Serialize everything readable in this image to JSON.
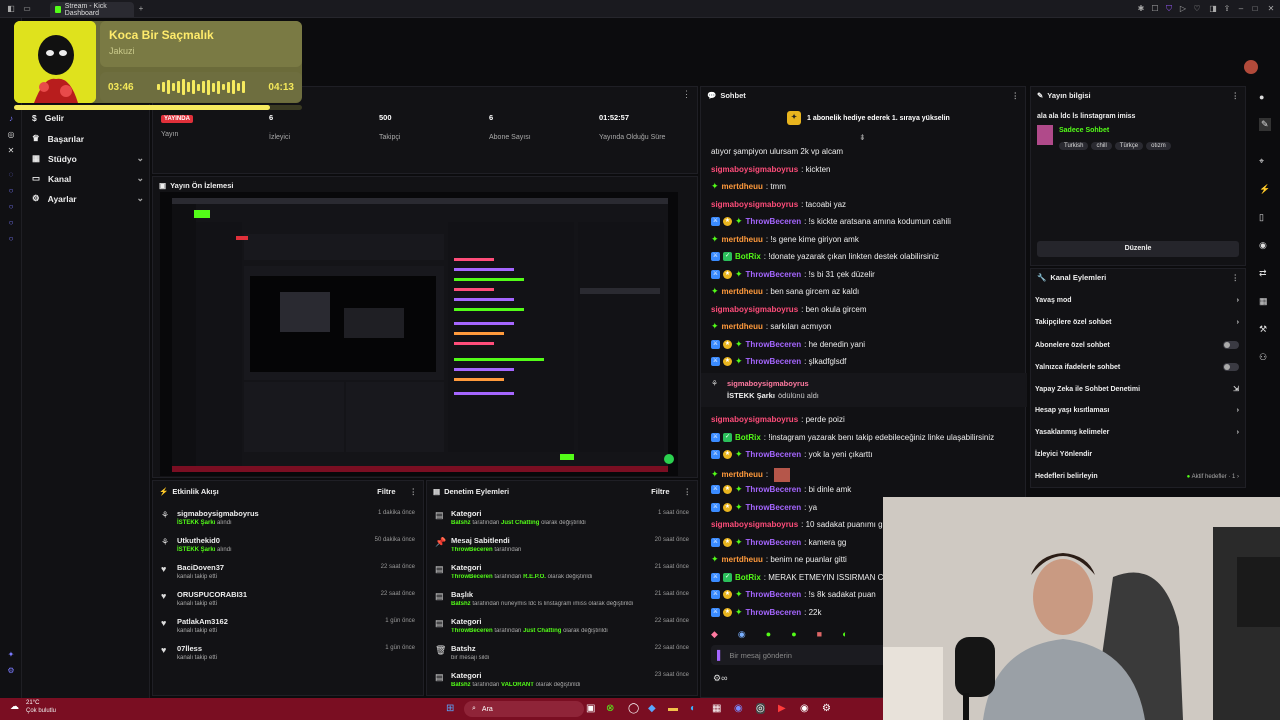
{
  "browser": {
    "tab_title": "Stream - Kick Dashboard"
  },
  "now_playing": {
    "title": "Koca Bir Saçmalık",
    "artist": "Jakuzi",
    "elapsed": "03:46",
    "duration": "04:13",
    "progress": 0.89
  },
  "nav": [
    {
      "label": "Gelir",
      "expandable": false
    },
    {
      "label": "Başarılar",
      "expandable": false
    },
    {
      "label": "Stüdyo",
      "expandable": true
    },
    {
      "label": "Kanal",
      "expandable": true
    },
    {
      "label": "Ayarlar",
      "expandable": true
    }
  ],
  "stats": [
    {
      "value": "YAYINDA",
      "label": "Yayın"
    },
    {
      "value": "6",
      "label": "İzleyici"
    },
    {
      "value": "500",
      "label": "Takipçi"
    },
    {
      "value": "6",
      "label": "Abone Sayısı"
    },
    {
      "value": "01:52:57",
      "label": "Yayında Olduğu Süre"
    }
  ],
  "preview": {
    "title": "Yayın Ön İzlemesi"
  },
  "activity": {
    "title": "Etkinlik Akışı",
    "filter": "Filtre",
    "items": [
      {
        "name": "sigmaboysigmaboyrus",
        "sub": "İSTEKK Şarkı",
        "sub2": "alındı",
        "time": "1 dakika önce"
      },
      {
        "name": "Utkuthekid0",
        "sub": "İSTEKK Şarkı",
        "sub2": "alındı",
        "time": "50 dakika önce"
      },
      {
        "name": "BaciDoven37",
        "sub": "",
        "sub2": "kanalı takip etti",
        "time": "22 saat önce"
      },
      {
        "name": "ORUSPUCORABI31",
        "sub": "",
        "sub2": "kanalı takip etti",
        "time": "22 saat önce"
      },
      {
        "name": "PatlakAm3162",
        "sub": "",
        "sub2": "kanalı takip etti",
        "time": "1 gün önce"
      },
      {
        "name": "07lless",
        "sub": "",
        "sub2": "kanalı takip etti",
        "time": "1 gün önce"
      }
    ]
  },
  "moderation": {
    "title": "Denetim Eylemleri",
    "filter": "Filtre",
    "items": [
      {
        "title": "Kategori",
        "actor": "Batshz",
        "mid": "tarafından",
        "target": "Just Chatting",
        "end": "olarak değiştirildi",
        "time": "1 saat önce"
      },
      {
        "title": "Mesaj Sabitlendi",
        "actor": "ThrowBeceren",
        "mid": "tarafından",
        "target": "",
        "end": "",
        "time": "20 saat önce"
      },
      {
        "title": "Kategori",
        "actor": "ThrowBeceren",
        "mid": "tarafından",
        "target": "R.E.P.O.",
        "end": "olarak değiştirildi",
        "time": "21 saat önce"
      },
      {
        "title": "Başlık",
        "actor": "Batshz",
        "mid": "tarafından",
        "target": "",
        "end": "nuneymis ldc ls linstagram imiss olarak değiştirildi",
        "time": "21 saat önce"
      },
      {
        "title": "Kategori",
        "actor": "ThrowBeceren",
        "mid": "tarafından",
        "target": "Just Chatting",
        "end": "olarak değiştirildi",
        "time": "22 saat önce"
      },
      {
        "title": "Batshz",
        "actor": "",
        "mid": "bir mesajı sildi",
        "target": "",
        "end": "",
        "time": "22 saat önce"
      },
      {
        "title": "Kategori",
        "actor": "Batshz",
        "mid": "tarafından",
        "target": "VALORANT",
        "end": "olarak değiştirildi",
        "time": "23 saat önce"
      }
    ]
  },
  "chat": {
    "title": "Sohbet",
    "banner": "1 abonelik hediye ederek 1. sıraya yükselin",
    "input_placeholder": "Bir mesaj gönderin",
    "messages": [
      {
        "user": "",
        "text": "atıyor şampiyon ulursam 2k vp alcam",
        "color": "none",
        "badges": []
      },
      {
        "user": "sigmaboysigmaboyrus",
        "text": ": kickten",
        "color": "pink",
        "badges": []
      },
      {
        "user": "mertdheuu",
        "text": ": tmm",
        "color": "orange",
        "badges": [
          "star"
        ]
      },
      {
        "user": "sigmaboysigmaboyrus",
        "text": ": tacoabi yaz",
        "color": "pink",
        "badges": []
      },
      {
        "user": "ThrowBeceren",
        "text": ": !s kickte aratsana amına kodumun cahili",
        "color": "purple",
        "badges": [
          "blue",
          "gold",
          "star"
        ]
      },
      {
        "user": "mertdheuu",
        "text": ": !s gene kime giriyon amk",
        "color": "orange",
        "badges": [
          "star"
        ]
      },
      {
        "user": "BotRix",
        "text": ": !donate yazarak çıkan linkten destek olabilirsiniz",
        "color": "green",
        "badges": [
          "blue",
          "green"
        ]
      },
      {
        "user": "ThrowBeceren",
        "text": ": !s bi 31 çek düzelir",
        "color": "purple",
        "badges": [
          "blue",
          "gold",
          "star"
        ]
      },
      {
        "user": "mertdheuu",
        "text": ": ben sana gircem az kaldı",
        "color": "orange",
        "badges": [
          "star"
        ]
      },
      {
        "user": "sigmaboysigmaboyrus",
        "text": ": ben okula gircem",
        "color": "pink",
        "badges": []
      },
      {
        "user": "mertdheuu",
        "text": ": sarkıları acmıyon",
        "color": "orange",
        "badges": [
          "star"
        ]
      },
      {
        "user": "ThrowBeceren",
        "text": ": he denedin yani",
        "color": "purple",
        "badges": [
          "blue",
          "gold",
          "star"
        ]
      },
      {
        "user": "ThrowBeceren",
        "text": ": şlkadfglsdf",
        "color": "purple",
        "badges": [
          "blue",
          "gold",
          "star"
        ]
      }
    ],
    "reward": {
      "user": "sigmaboysigmaboyrus",
      "reward": "İSTEKK Şarkı",
      "text": "ödülünü aldı"
    },
    "messages2": [
      {
        "user": "sigmaboysigmaboyrus",
        "text": ": perde poizi",
        "color": "pink",
        "badges": []
      },
      {
        "user": "BotRix",
        "text": ": !instagram yazarak benı takip edebileceğiniz linke ulaşabilirsiniz",
        "color": "green",
        "badges": [
          "blue",
          "green"
        ]
      },
      {
        "user": "ThrowBeceren",
        "text": ": yok la yeni çıkarttı",
        "color": "purple",
        "badges": [
          "blue",
          "gold",
          "star"
        ]
      },
      {
        "user": "mertdheuu",
        "text": ":",
        "color": "orange",
        "badges": [
          "star"
        ]
      },
      {
        "user": "ThrowBeceren",
        "text": ": bi dinle amk",
        "color": "purple",
        "badges": [
          "blue",
          "gold",
          "star"
        ]
      },
      {
        "user": "ThrowBeceren",
        "text": ": ya",
        "color": "purple",
        "badges": [
          "blue",
          "gold",
          "star"
        ]
      },
      {
        "user": "sigmaboysigmaboyrus",
        "text": ": 10 sadakat puanımı g",
        "color": "pink",
        "badges": []
      },
      {
        "user": "ThrowBeceren",
        "text": ": kamera gg",
        "color": "purple",
        "badges": [
          "blue",
          "gold",
          "star"
        ]
      },
      {
        "user": "mertdheuu",
        "text": ": benim ne puanlar gitti",
        "color": "orange",
        "badges": [
          "star"
        ]
      },
      {
        "user": "BotRix",
        "text": ": MERAK ETMEYIN ISSIRMAN C",
        "color": "green",
        "badges": [
          "blue",
          "green"
        ]
      },
      {
        "user": "ThrowBeceren",
        "text": ": !s 8k sadakat puan",
        "color": "purple",
        "badges": [
          "blue",
          "gold",
          "star"
        ]
      },
      {
        "user": "ThrowBeceren",
        "text": ": 22k",
        "color": "purple",
        "badges": [
          "blue",
          "gold",
          "star"
        ]
      }
    ]
  },
  "stream_info": {
    "title": "Yayın bilgisi",
    "stream_title": "ala ala ldc ls linstagram imiss",
    "category": "Sadece Sohbet",
    "tags": [
      "Turkish",
      "chill",
      "Türkçe",
      "otızm"
    ],
    "edit_label": "Düzenle"
  },
  "channel_actions": {
    "title": "Kanal Eylemleri",
    "rows": [
      {
        "label": "Yavaş mod",
        "control": "chevron"
      },
      {
        "label": "Takipçilere özel sohbet",
        "control": "chevron"
      },
      {
        "label": "Abonelere özel sohbet",
        "control": "toggle"
      },
      {
        "label": "Yalnızca ifadelerle sohbet",
        "control": "toggle"
      },
      {
        "label": "Yapay Zeka ile Sohbet Denetimi",
        "control": "external"
      },
      {
        "label": "Hesap yaşı kısıtlaması",
        "control": "chevron"
      },
      {
        "label": "Yasaklanmış kelimeler",
        "control": "chevron"
      },
      {
        "label": "İzleyici Yönlendir",
        "control": "none"
      },
      {
        "label": "Hedefleri belirleyin",
        "control": "goal",
        "extra": "Aktif hedefler · 1"
      }
    ]
  },
  "taskbar": {
    "weather_temp": "21°C",
    "weather_desc": "Çok bulutlu",
    "search": "Ara"
  }
}
